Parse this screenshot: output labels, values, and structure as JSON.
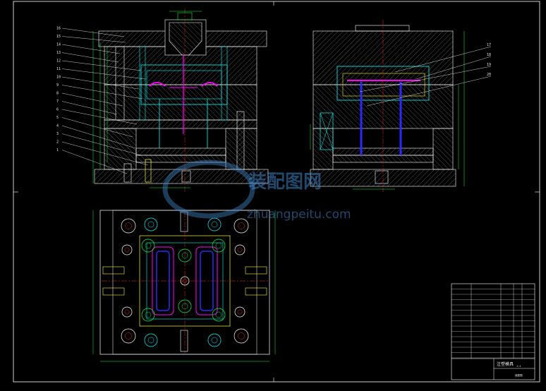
{
  "watermark": {
    "cn": "装配图网",
    "url": "zhuangpeitu.com"
  },
  "part_numbers_left": [
    "16",
    "15",
    "14",
    "13",
    "12",
    "11",
    "10",
    "9",
    "8",
    "7",
    "6",
    "5",
    "4",
    "3",
    "2",
    "1"
  ],
  "part_numbers_right": [
    "17",
    "18",
    "19",
    "20"
  ],
  "colors": {
    "frame": "#ffffff",
    "hatch": "#9a9a9a",
    "dim": "#00ff3c",
    "cyan": "#00ffff",
    "blue": "#2a2aff",
    "magenta": "#ff00ff",
    "yellow": "#ffff00",
    "red": "#ff2020"
  },
  "title_block": {
    "title": "注塑模具",
    "drawing_no": "装配图",
    "scale": "1:1"
  }
}
